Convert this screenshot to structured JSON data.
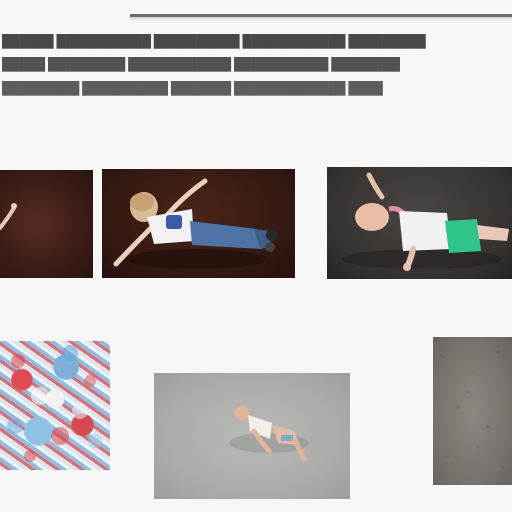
{
  "text_lines": [
    "██████ ███████████ ██████████ ████████████ █████████",
    "█████ █████████ ████████████ ███████████ ████████",
    "█████████ ██████████ ███████ █████████████ ████"
  ],
  "colors": {
    "background": "#f7f7f7",
    "rule": "#6b6b6b",
    "text": "#222222"
  },
  "images": [
    {
      "name": "figure-tile-1",
      "subject": "child-lying-partial"
    },
    {
      "name": "figure-tile-2",
      "subject": "child-lying-jeans"
    },
    {
      "name": "figure-tile-3",
      "subject": "child-lying-green-shorts"
    },
    {
      "name": "figure-tile-4",
      "subject": "colorful-texture"
    },
    {
      "name": "figure-tile-5",
      "subject": "infant-on-floor"
    },
    {
      "name": "figure-tile-6",
      "subject": "carpet-texture"
    }
  ]
}
